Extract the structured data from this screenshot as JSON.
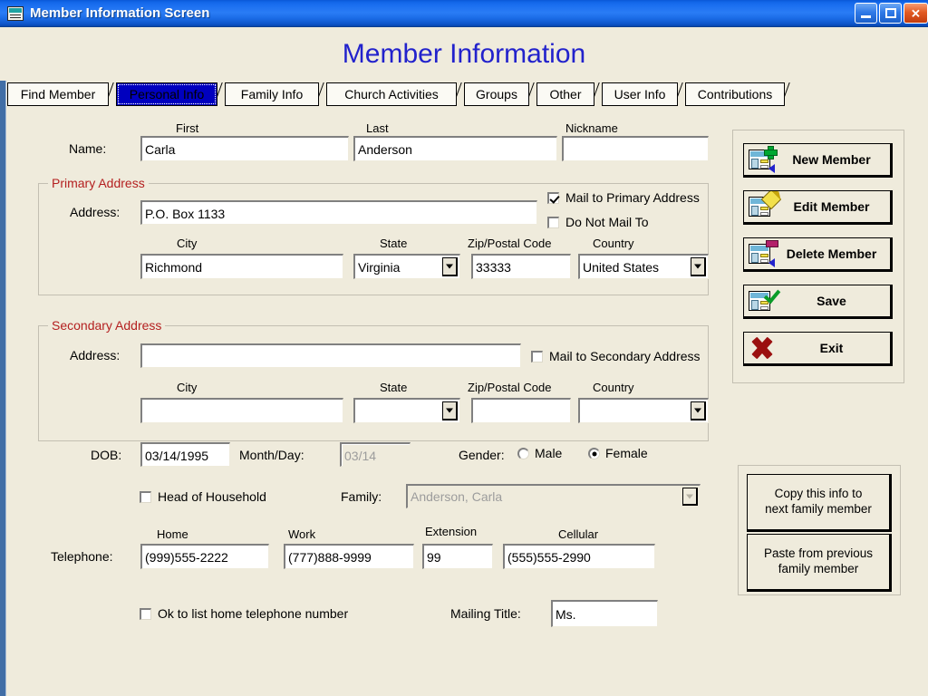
{
  "window": {
    "title": "Member Information Screen",
    "icon": "application-icon",
    "minimize_label": "Minimize",
    "maximize_label": "Maximize",
    "close_label": "Close"
  },
  "page": {
    "heading": "Member Information",
    "heading_color": "#2222cc"
  },
  "tabs": [
    {
      "label": "Find Member",
      "selected": false
    },
    {
      "label": "Personal Info",
      "selected": true
    },
    {
      "label": "Family Info",
      "selected": false
    },
    {
      "label": "Church Activities",
      "selected": false
    },
    {
      "label": "Groups",
      "selected": false
    },
    {
      "label": "Other",
      "selected": false
    },
    {
      "label": "User Info",
      "selected": false
    },
    {
      "label": "Contributions",
      "selected": false
    }
  ],
  "name_row": {
    "row_label": "Name:",
    "first_caption": "First",
    "first_value": "Carla",
    "last_caption": "Last",
    "last_value": "Anderson",
    "nickname_caption": "Nickname",
    "nickname_value": ""
  },
  "primary_address": {
    "legend": "Primary Address",
    "legend_color": "#b42020",
    "address_label": "Address:",
    "address_value": "P.O. Box 1133",
    "mail_to_primary_label": "Mail to Primary Address",
    "mail_to_primary_checked": true,
    "do_not_mail_label": "Do Not Mail To",
    "do_not_mail_checked": false,
    "city_caption": "City",
    "city_value": "Richmond",
    "state_caption": "State",
    "state_value": "Virginia",
    "zip_caption": "Zip/Postal Code",
    "zip_value": "33333",
    "country_caption": "Country",
    "country_value": "United States"
  },
  "secondary_address": {
    "legend": "Secondary Address",
    "address_label": "Address:",
    "address_value": "",
    "mail_to_secondary_label": "Mail to Secondary Address",
    "mail_to_secondary_checked": false,
    "city_caption": "City",
    "city_value": "",
    "state_caption": "State",
    "state_value": "",
    "zip_caption": "Zip/Postal Code",
    "zip_value": "",
    "country_caption": "Country",
    "country_value": ""
  },
  "dob_row": {
    "dob_label": "DOB:",
    "dob_value": "03/14/1995",
    "monthday_label": "Month/Day:",
    "monthday_value": "03/14",
    "monthday_disabled": true,
    "gender_label": "Gender:",
    "male_label": "Male",
    "female_label": "Female",
    "gender_selected": "Female"
  },
  "family_row": {
    "head_of_household_label": "Head of Household",
    "head_of_household_checked": false,
    "family_label": "Family:",
    "family_value": "Anderson, Carla",
    "family_disabled": true
  },
  "telephone": {
    "row_label": "Telephone:",
    "home_caption": "Home",
    "home_value": "(999)555-2222",
    "work_caption": "Work",
    "work_value": "(777)888-9999",
    "extension_caption": "Extension",
    "extension_value": "99",
    "cellular_caption": "Cellular",
    "cellular_value": "(555)555-2990"
  },
  "bottom_row": {
    "ok_to_list_label": "Ok to list home telephone number",
    "ok_to_list_checked": false,
    "mailing_title_label": "Mailing Title:",
    "mailing_title_value": "Ms."
  },
  "actions": {
    "new_member": "New Member",
    "edit_member": "Edit Member",
    "delete_member": "Delete Member",
    "save": "Save",
    "exit": "Exit"
  },
  "copy_paste": {
    "copy_line1": "Copy this info to",
    "copy_line2": "next family member",
    "paste_line1": "Paste from previous",
    "paste_line2": "family member"
  }
}
